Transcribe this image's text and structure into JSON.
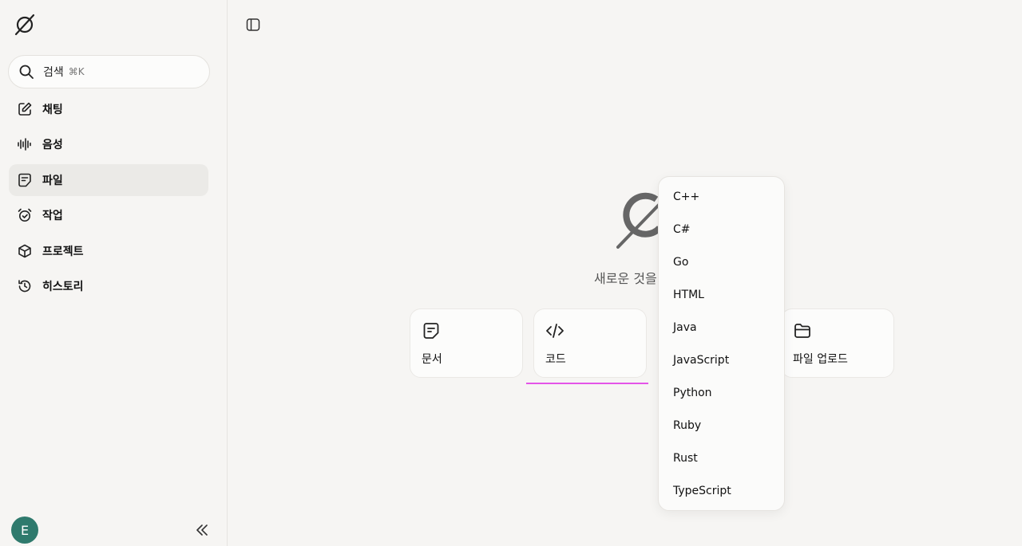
{
  "sidebar": {
    "search": {
      "label": "검색",
      "shortcut": "⌘K"
    },
    "items": [
      {
        "label": "채팅",
        "icon": "edit-icon",
        "active": false
      },
      {
        "label": "음성",
        "icon": "waveform-icon",
        "active": false
      },
      {
        "label": "파일",
        "icon": "file-note-icon",
        "active": true
      },
      {
        "label": "작업",
        "icon": "alarm-clock-icon",
        "active": false
      },
      {
        "label": "프로젝트",
        "icon": "cube-icon",
        "active": false
      },
      {
        "label": "히스토리",
        "icon": "history-icon",
        "active": false
      }
    ],
    "user": {
      "avatar_initial": "E"
    }
  },
  "main": {
    "tagline": "새로운 것을",
    "cards": [
      {
        "label": "문서",
        "icon": "document-icon"
      },
      {
        "label": "코드",
        "icon": "code-icon"
      },
      {
        "label": "파일 업로드",
        "icon": "folder-icon"
      }
    ]
  },
  "dropdown": {
    "options": [
      "C++",
      "C#",
      "Go",
      "HTML",
      "Java",
      "JavaScript",
      "Python",
      "Ruby",
      "Rust",
      "TypeScript"
    ]
  },
  "colors": {
    "background": "#f6f5f3",
    "active_item": "#ebeae7",
    "avatar": "#2f7a6d",
    "underline": "#e454e8"
  }
}
